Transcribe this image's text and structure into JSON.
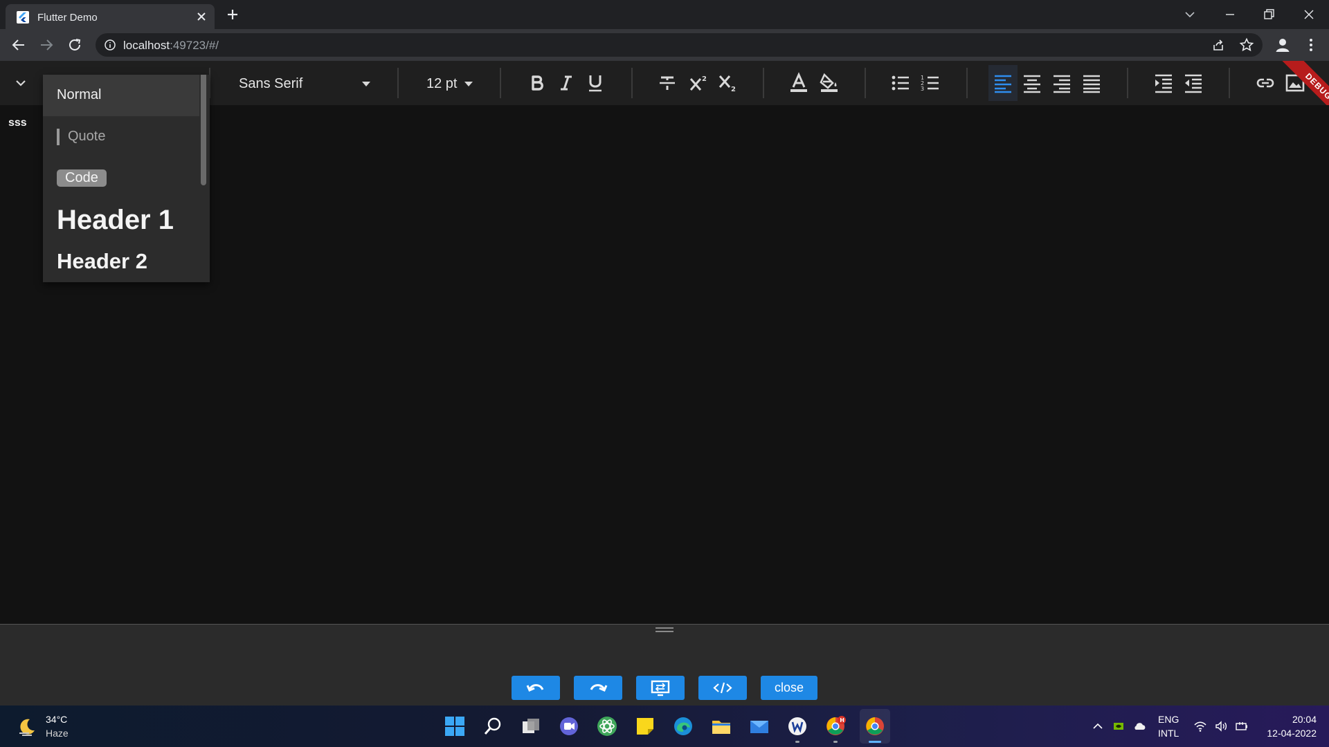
{
  "browser": {
    "tab_title": "Flutter Demo",
    "url_host": "localhost",
    "url_rest": ":49723/#/"
  },
  "toolbar": {
    "font_family": "Sans Serif",
    "font_size": "12 pt",
    "debug_label": "DEBUG",
    "accent_color": "#1e88e5"
  },
  "style_menu": {
    "items": [
      "Normal",
      "Quote",
      "Code",
      "Header 1",
      "Header 2"
    ],
    "selected": "Normal"
  },
  "editor": {
    "content": "sss"
  },
  "bottom_panel": {
    "close_label": "close"
  },
  "taskbar": {
    "weather_temp": "34°C",
    "weather_desc": "Haze",
    "lang_line1": "ENG",
    "lang_line2": "INTL",
    "time": "20:04",
    "date": "12-04-2022",
    "chrome_badge": "H"
  },
  "icons": {
    "tab": [
      "flutter-icon",
      "close-icon",
      "plus-icon"
    ],
    "window": [
      "chevron-down-icon",
      "minimize-icon",
      "restore-icon",
      "close-icon"
    ],
    "toolbar": [
      "chevron-down-icon",
      "bold-icon",
      "italic-icon",
      "underline-icon",
      "strikethrough-icon",
      "superscript-icon",
      "subscript-icon",
      "text-color-icon",
      "fill-color-icon",
      "bullet-list-icon",
      "numbered-list-icon",
      "align-left-icon",
      "align-center-icon",
      "align-right-icon",
      "align-justify-icon",
      "indent-icon",
      "outdent-icon",
      "link-icon",
      "image-icon"
    ],
    "panel": [
      "undo-icon",
      "redo-icon",
      "swap-view-icon",
      "code-view-icon"
    ]
  }
}
